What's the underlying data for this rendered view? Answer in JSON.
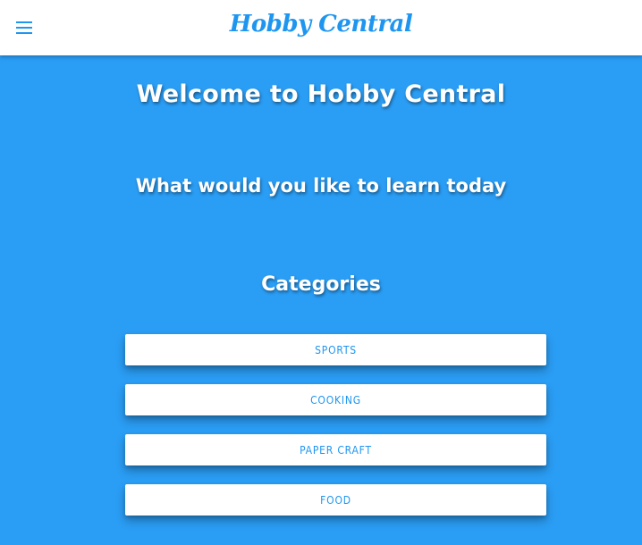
{
  "header": {
    "menu_icon": "menu-icon",
    "brand": "Hobby Central"
  },
  "hero": {
    "welcome": "Welcome to Hobby Central",
    "subtitle": "What would you like to learn today",
    "categories_title": "Categories"
  },
  "categories": [
    {
      "label": "SPORTS"
    },
    {
      "label": "COOKING"
    },
    {
      "label": "PAPER CRAFT"
    },
    {
      "label": "FOOD"
    }
  ],
  "colors": {
    "accent": "#1e96f0",
    "background": "#2a9df4",
    "header_bg": "#ffffff"
  }
}
